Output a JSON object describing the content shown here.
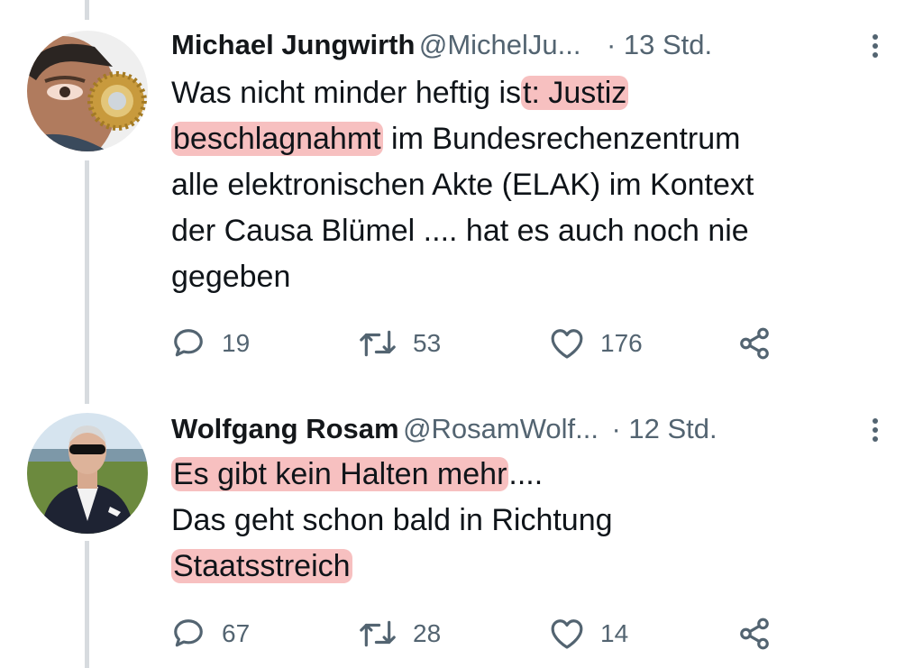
{
  "tweets": [
    {
      "name": "Michael Jungwirth",
      "handle": "@MichelJu...",
      "time": "· 13 Std.",
      "lines": [
        {
          "before": "Was nicht minder heftig is",
          "hl": "t: Justiz",
          "after": ""
        },
        {
          "before": "",
          "hl": "beschlagnahmt",
          "after": " im Bundesrechenzentrum"
        },
        {
          "before": "alle elektronischen Akte (ELAK) im Kontext",
          "hl": "",
          "after": ""
        },
        {
          "before": "der Causa Blümel .... hat es auch noch nie",
          "hl": "",
          "after": ""
        },
        {
          "before": "gegeben",
          "hl": "",
          "after": ""
        }
      ],
      "replies": "19",
      "retweets": "53",
      "likes": "176"
    },
    {
      "name": "Wolfgang Rosam",
      "handle": "@RosamWolf...",
      "time": "· 12 Std.",
      "lines": [
        {
          "before": "",
          "hl": "Es gibt kein Halten mehr",
          "after": "...."
        },
        {
          "before": "Das geht schon bald in Richtung",
          "hl": "",
          "after": ""
        },
        {
          "before": "",
          "hl": "Staatsstreich",
          "after": ""
        }
      ],
      "replies": "67",
      "retweets": "28",
      "likes": "14"
    }
  ],
  "icons": {
    "reply": "reply-icon",
    "retweet": "retweet-icon",
    "like": "like-icon",
    "share": "share-icon",
    "more": "more-options-icon"
  },
  "colors": {
    "highlight": "#f08282",
    "muted": "#536471",
    "thread_line": "#d7dbdf"
  }
}
